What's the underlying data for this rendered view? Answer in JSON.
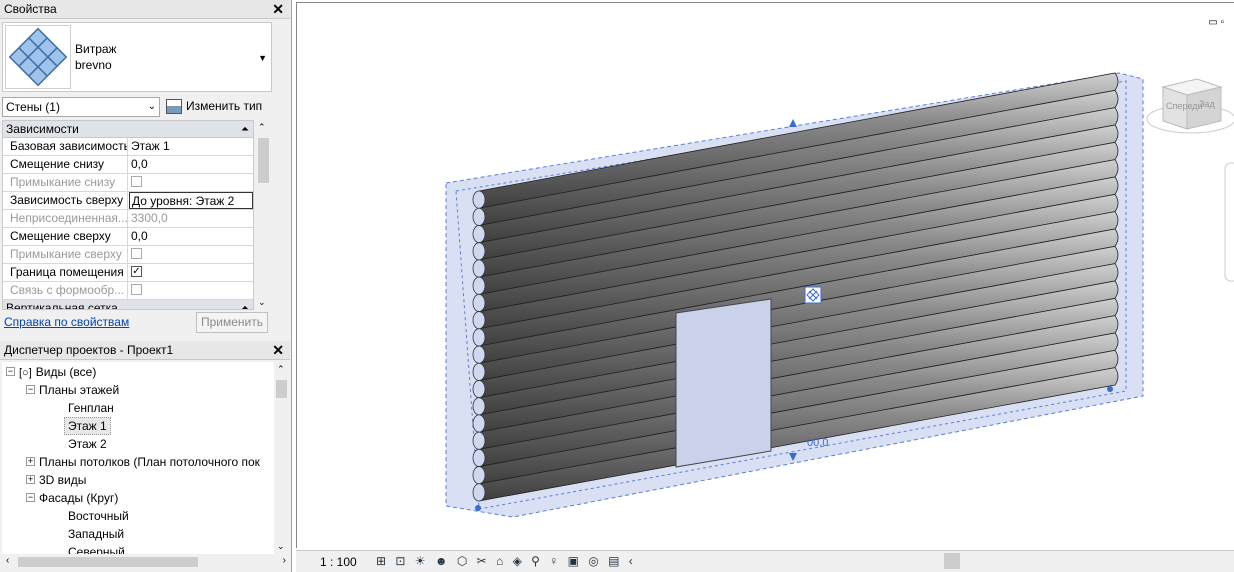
{
  "properties_panel": {
    "title": "Свойства",
    "close": "✕",
    "type_name_line1": "Витраж",
    "type_name_line2": "brevno",
    "instance_selector": "Стены (1)",
    "edit_type": "Изменить тип",
    "groups": [
      {
        "label": "Зависимости"
      },
      {
        "label": "Вертикальная сетка"
      }
    ],
    "rows": [
      {
        "key": "Базовая зависимость",
        "value": "Этаж 1",
        "disabled": false
      },
      {
        "key": "Смещение снизу",
        "value": "0,0",
        "disabled": false
      },
      {
        "key": "Примыкание снизу",
        "value": "",
        "checkbox": false,
        "disabled": true
      },
      {
        "key": "Зависимость сверху",
        "value": "До уровня: Этаж 2",
        "disabled": false
      },
      {
        "key": "Неприсоединенная...",
        "value": "3300,0",
        "disabled": true
      },
      {
        "key": "Смещение сверху",
        "value": "0,0",
        "disabled": false
      },
      {
        "key": "Примыкание сверху",
        "value": "",
        "checkbox": false,
        "disabled": true
      },
      {
        "key": "Граница помещения",
        "value": "",
        "checkbox": true,
        "disabled": false
      },
      {
        "key": "Связь с формообр...",
        "value": "",
        "checkbox": false,
        "disabled": true
      }
    ],
    "help_link": "Справка по свойствам",
    "apply": "Применить"
  },
  "project_browser": {
    "title": "Диспетчер проектов - Проект1",
    "close": "✕",
    "items": [
      {
        "label": "Виды (все)",
        "toggle": "−"
      },
      {
        "label": "Планы этажей",
        "toggle": "−"
      },
      {
        "label": "Генплан",
        "toggle": ""
      },
      {
        "label": "Этаж 1",
        "toggle": "",
        "selected": true
      },
      {
        "label": "Этаж 2",
        "toggle": ""
      },
      {
        "label": "Планы потолков (План потолочного пок",
        "toggle": "+"
      },
      {
        "label": "3D виды",
        "toggle": "+"
      },
      {
        "label": "Фасады (Круг)",
        "toggle": "−"
      },
      {
        "label": "Восточный",
        "toggle": ""
      },
      {
        "label": "Западный",
        "toggle": ""
      },
      {
        "label": "Северный",
        "toggle": ""
      }
    ]
  },
  "viewport": {
    "viewcube_left": "Спереди",
    "viewcube_right": "Зад",
    "dim_text": "00,0",
    "log_color": "#6f6f6f",
    "selection_color": "#5a7fd6"
  },
  "statusbar": {
    "scale": "1 : 100",
    "icons": "⊞ ⊡ ☀ ☻ ⬡ ✂ ⌂ ◈ ⚲ ♀ ▣ ◎ ▤ ‹"
  }
}
